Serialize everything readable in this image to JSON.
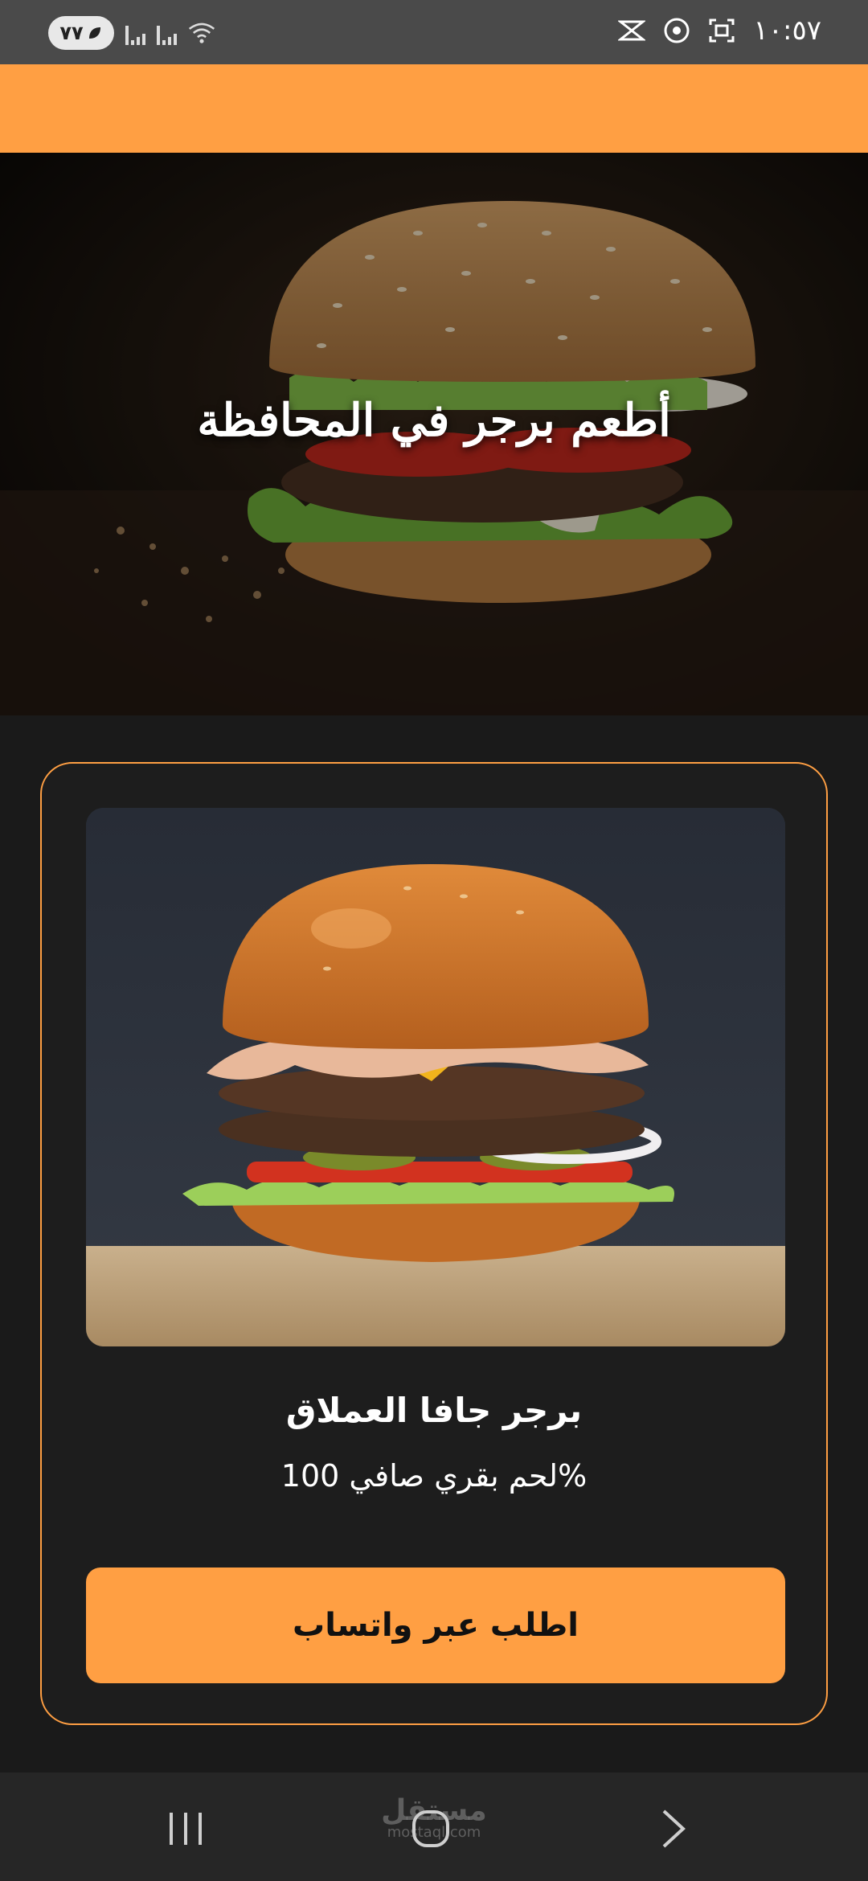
{
  "status_bar": {
    "time": "١٠:٥٧",
    "battery": "٧٧"
  },
  "hero": {
    "title": "أطعم برجر في المحافظة"
  },
  "product": {
    "name": "برجر جافا العملاق",
    "description": "لحم بقري صافي 100%",
    "order_label": "اطلب عبر واتساب"
  },
  "watermark": {
    "brand": "مستقل",
    "domain": "mostaql.com"
  },
  "colors": {
    "accent": "#FF9F43",
    "background": "#1a1a1a",
    "card": "#1d1d1d"
  },
  "icons": [
    "signal-icon",
    "wifi-icon",
    "screenshot-icon",
    "chrome-icon",
    "cast-icon",
    "recents-icon",
    "home-icon",
    "back-icon"
  ]
}
